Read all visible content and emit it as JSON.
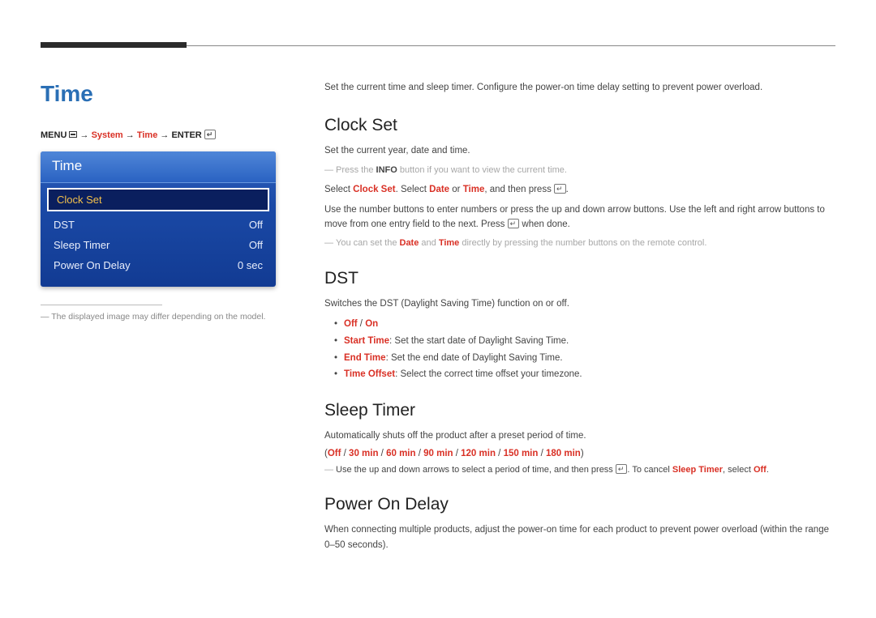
{
  "page": {
    "title": "Time",
    "breadcrumb": {
      "menu": "MENU",
      "arrow": "→",
      "system": "System",
      "time": "Time",
      "enter": "ENTER"
    }
  },
  "osd": {
    "title": "Time",
    "items": [
      {
        "label": "Clock Set",
        "value": "",
        "selected": true
      },
      {
        "label": "DST",
        "value": "Off",
        "selected": false
      },
      {
        "label": "Sleep Timer",
        "value": "Off",
        "selected": false
      },
      {
        "label": "Power On Delay",
        "value": "0 sec",
        "selected": false
      }
    ]
  },
  "footnote": "The displayed image may differ depending on the model.",
  "intro": "Set the current time and sleep timer. Configure the power-on time delay setting to prevent power overload.",
  "clockset": {
    "heading": "Clock Set",
    "p1": "Set the current year, date and time.",
    "tip1_a": "Press the ",
    "tip1_b": "INFO",
    "tip1_c": " button if you want to view the current time.",
    "p2_a": "Select ",
    "p2_b": "Clock Set",
    "p2_c": ". Select ",
    "p2_d": "Date",
    "p2_e": " or ",
    "p2_f": "Time",
    "p2_g": ", and then press ",
    "p2_h": ".",
    "p3": "Use the number buttons to enter numbers or press the up and down arrow buttons. Use the left and right arrow buttons to move from one entry field to the next. Press ",
    "p3_b": " when done.",
    "tip2_a": "You can set the ",
    "tip2_b": "Date",
    "tip2_c": " and ",
    "tip2_d": "Time",
    "tip2_e": " directly by pressing the number buttons on the remote control."
  },
  "dst": {
    "heading": "DST",
    "p1": "Switches the DST (Daylight Saving Time) function on or off.",
    "bullets": {
      "b1_a": "Off",
      "b1_b": " / ",
      "b1_c": "On",
      "b2_a": "Start Time",
      "b2_b": ": Set the start date of Daylight Saving Time.",
      "b3_a": "End Time",
      "b3_b": ": Set the end date of Daylight Saving Time.",
      "b4_a": "Time Offset",
      "b4_b": ": Select the correct time offset your timezone."
    }
  },
  "sleep": {
    "heading": "Sleep Timer",
    "p1": "Automatically shuts off the product after a preset period of time.",
    "opts": {
      "o0": "(",
      "o1": "Off",
      "s": " / ",
      "o2": "30 min",
      "o3": "60 min",
      "o4": "90 min",
      "o5": "120 min",
      "o6": "150 min",
      "o7": "180 min",
      "o8": ")"
    },
    "tip_a": "Use the up and down arrows to select a period of time, and then press ",
    "tip_b": ". To cancel ",
    "tip_c": "Sleep Timer",
    "tip_d": ", select ",
    "tip_e": "Off",
    "tip_f": "."
  },
  "powerondelay": {
    "heading": "Power On Delay",
    "p1": "When connecting multiple products, adjust the power-on time for each product to prevent power overload (within the range 0–50 seconds)."
  }
}
